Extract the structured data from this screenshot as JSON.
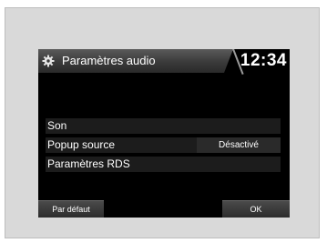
{
  "header": {
    "title": "Paramètres audio",
    "clock": "12:34",
    "icon": "gear-icon"
  },
  "menu": {
    "items": [
      {
        "label": "Son",
        "value": ""
      },
      {
        "label": "Popup source",
        "value": "Désactivé"
      },
      {
        "label": "Paramètres RDS",
        "value": ""
      }
    ]
  },
  "footer": {
    "default_label": "Par défaut",
    "ok_label": "OK"
  }
}
